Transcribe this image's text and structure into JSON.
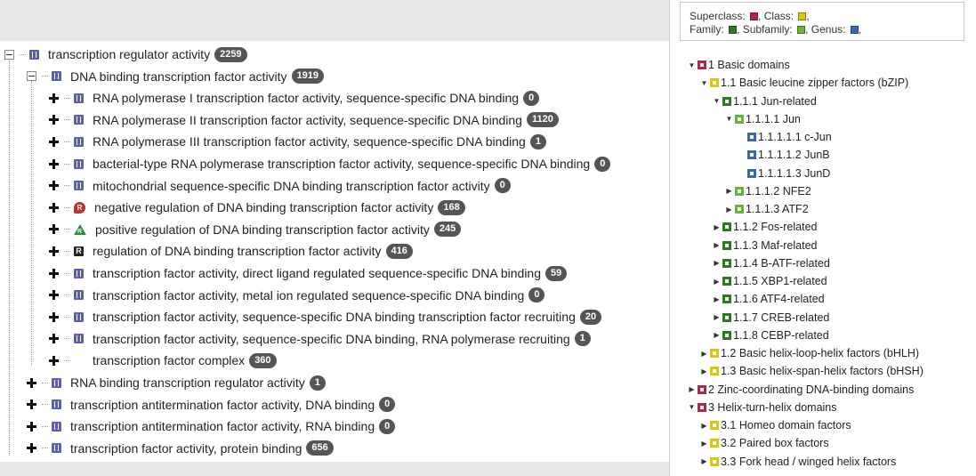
{
  "left_tree": {
    "rows": [
      {
        "label": "transcription regulator activity",
        "count": "2259",
        "toggle": "minus",
        "icon": "mf",
        "level": 0
      },
      {
        "label": "DNA binding transcription factor activity",
        "count": "1919",
        "toggle": "minus",
        "icon": "mf",
        "level": 1
      },
      {
        "label": "RNA polymerase I transcription factor activity, sequence-specific DNA binding",
        "count": "0",
        "toggle": "plus",
        "icon": "mf",
        "level": 2
      },
      {
        "label": "RNA polymerase II transcription factor activity, sequence-specific DNA binding",
        "count": "1120",
        "toggle": "plus",
        "icon": "mf",
        "level": 2
      },
      {
        "label": "RNA polymerase III transcription factor activity, sequence-specific DNA binding",
        "count": "1",
        "toggle": "plus",
        "icon": "mf",
        "level": 2
      },
      {
        "label": "bacterial-type RNA polymerase transcription factor activity, sequence-specific DNA binding",
        "count": "0",
        "toggle": "plus",
        "icon": "mf",
        "level": 2
      },
      {
        "label": "mitochondrial sequence-specific DNA binding transcription factor activity",
        "count": "0",
        "toggle": "plus",
        "icon": "mf",
        "level": 2
      },
      {
        "label": "negative regulation of DNA binding transcription factor activity",
        "count": "168",
        "toggle": "plus",
        "icon": "neg",
        "level": 2
      },
      {
        "label": "positive regulation of DNA binding transcription factor activity",
        "count": "245",
        "toggle": "plus",
        "icon": "pos",
        "level": 2
      },
      {
        "label": "regulation of DNA binding transcription factor activity",
        "count": "416",
        "toggle": "plus",
        "icon": "reg",
        "level": 2
      },
      {
        "label": "transcription factor activity, direct ligand regulated sequence-specific DNA binding",
        "count": "59",
        "toggle": "plus",
        "icon": "mf",
        "level": 2
      },
      {
        "label": "transcription factor activity, metal ion regulated sequence-specific DNA binding",
        "count": "0",
        "toggle": "plus",
        "icon": "mf",
        "level": 2
      },
      {
        "label": "transcription factor activity, sequence-specific DNA binding transcription factor recruiting",
        "count": "20",
        "toggle": "plus",
        "icon": "mf",
        "level": 2
      },
      {
        "label": "transcription factor activity, sequence-specific DNA binding, RNA polymerase recruiting",
        "count": "1",
        "toggle": "plus",
        "icon": "mf",
        "level": 2
      },
      {
        "label": "transcription factor complex",
        "count": "360",
        "toggle": "plus",
        "icon": "none",
        "level": 2
      },
      {
        "label": "RNA binding transcription regulator activity",
        "count": "1",
        "toggle": "plus",
        "icon": "mf",
        "level": 1
      },
      {
        "label": "transcription antitermination factor activity, DNA binding",
        "count": "0",
        "toggle": "plus",
        "icon": "mf",
        "level": 1
      },
      {
        "label": "transcription antitermination factor activity, RNA binding",
        "count": "0",
        "toggle": "plus",
        "icon": "mf",
        "level": 1
      },
      {
        "label": "transcription factor activity, protein binding",
        "count": "656",
        "toggle": "plus",
        "icon": "mf",
        "level": 1
      }
    ],
    "icon_letters": {
      "neg": "R",
      "pos": "R",
      "reg": "R"
    }
  },
  "legend": {
    "superclass": "Superclass:",
    "class": "Class:",
    "family": "Family:",
    "subfamily": "Subfamily:",
    "genus": "Genus:",
    "sep": ","
  },
  "colors": {
    "superclass": "#b0264a",
    "class": "#d9c617",
    "family": "#2f7a1f",
    "subfamily": "#6bb13a",
    "genus": "#3c67a8"
  },
  "right_tree": {
    "rows": [
      {
        "label": "1 Basic domains",
        "kind": "superclass",
        "arrow": "down",
        "level": 0
      },
      {
        "label": "1.1 Basic leucine zipper factors (bZIP)",
        "kind": "class",
        "arrow": "down",
        "level": 1
      },
      {
        "label": "1.1.1 Jun-related",
        "kind": "family",
        "arrow": "down",
        "level": 2
      },
      {
        "label": "1.1.1.1 Jun",
        "kind": "subfamily",
        "arrow": "down",
        "level": 3
      },
      {
        "label": "1.1.1.1.1 c-Jun",
        "kind": "genus",
        "arrow": "none",
        "level": 4
      },
      {
        "label": "1.1.1.1.2 JunB",
        "kind": "genus",
        "arrow": "none",
        "level": 4
      },
      {
        "label": "1.1.1.1.3 JunD",
        "kind": "genus",
        "arrow": "none",
        "level": 4
      },
      {
        "label": "1.1.1.2 NFE2",
        "kind": "subfamily",
        "arrow": "right",
        "level": 3
      },
      {
        "label": "1.1.1.3 ATF2",
        "kind": "subfamily",
        "arrow": "right",
        "level": 3
      },
      {
        "label": "1.1.2 Fos-related",
        "kind": "family",
        "arrow": "right",
        "level": 2
      },
      {
        "label": "1.1.3 Maf-related",
        "kind": "family",
        "arrow": "right",
        "level": 2
      },
      {
        "label": "1.1.4 B-ATF-related",
        "kind": "family",
        "arrow": "right",
        "level": 2
      },
      {
        "label": "1.1.5 XBP1-related",
        "kind": "family",
        "arrow": "right",
        "level": 2
      },
      {
        "label": "1.1.6 ATF4-related",
        "kind": "family",
        "arrow": "right",
        "level": 2
      },
      {
        "label": "1.1.7 CREB-related",
        "kind": "family",
        "arrow": "right",
        "level": 2
      },
      {
        "label": "1.1.8 CEBP-related",
        "kind": "family",
        "arrow": "right",
        "level": 2
      },
      {
        "label": "1.2 Basic helix-loop-helix factors (bHLH)",
        "kind": "class",
        "arrow": "right",
        "level": 1
      },
      {
        "label": "1.3 Basic helix-span-helix factors (bHSH)",
        "kind": "class",
        "arrow": "right",
        "level": 1
      },
      {
        "label": "2 Zinc-coordinating DNA-binding domains",
        "kind": "superclass",
        "arrow": "right",
        "level": 0
      },
      {
        "label": "3 Helix-turn-helix domains",
        "kind": "superclass",
        "arrow": "down",
        "level": 0
      },
      {
        "label": "3.1 Homeo domain factors",
        "kind": "class",
        "arrow": "right",
        "level": 1
      },
      {
        "label": "3.2 Paired box factors",
        "kind": "class",
        "arrow": "right",
        "level": 1
      },
      {
        "label": "3.3 Fork head / winged helix factors",
        "kind": "class",
        "arrow": "right",
        "level": 1
      }
    ]
  }
}
